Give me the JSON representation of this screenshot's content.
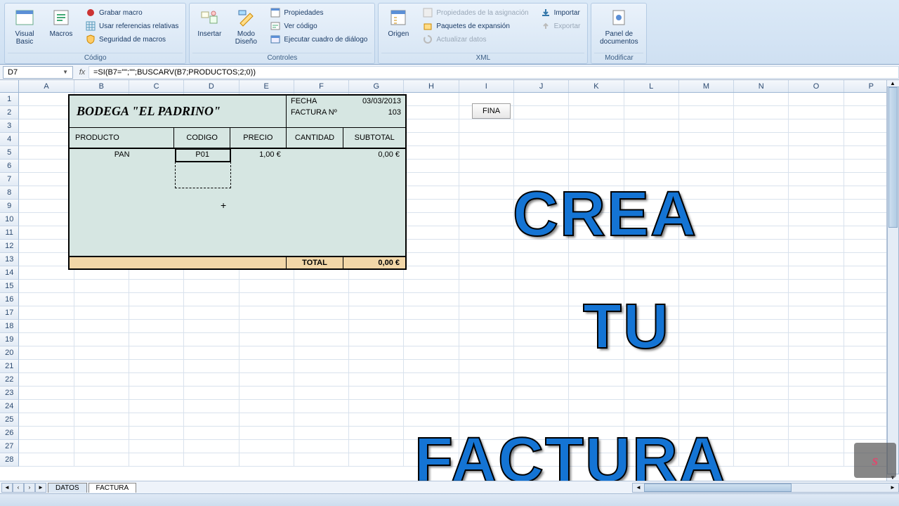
{
  "ribbon": {
    "codigo": {
      "label": "Código",
      "visual_basic": "Visual\nBasic",
      "macros": "Macros",
      "grabar": "Grabar macro",
      "refs": "Usar referencias relativas",
      "seguridad": "Seguridad de macros"
    },
    "controles": {
      "label": "Controles",
      "insertar": "Insertar",
      "modo": "Modo\nDiseño",
      "props": "Propiedades",
      "codigo": "Ver código",
      "dialogo": "Ejecutar cuadro de diálogo"
    },
    "xml": {
      "label": "XML",
      "origen": "Origen",
      "asig": "Propiedades de la asignación",
      "paq": "Paquetes de expansión",
      "act": "Actualizar datos",
      "importar": "Importar",
      "exportar": "Exportar"
    },
    "modificar": {
      "label": "Modificar",
      "panel": "Panel de\ndocumentos"
    }
  },
  "namebox": "D7",
  "formula": "=SI(B7=\"\";\"\";BUSCARV(B7;PRODUCTOS;2;0))",
  "columns": [
    "A",
    "B",
    "C",
    "D",
    "E",
    "F",
    "G",
    "H",
    "I",
    "J",
    "K",
    "L",
    "M",
    "N",
    "O",
    "P"
  ],
  "invoice": {
    "title": "BODEGA \"EL PADRINO\"",
    "fecha_lbl": "FECHA",
    "fecha_val": "03/03/2013",
    "num_lbl": "FACTURA Nº",
    "num_val": "103",
    "cols": {
      "producto": "PRODUCTO",
      "codigo": "CODIGO",
      "precio": "PRECIO",
      "cantidad": "CANTIDAD",
      "subtotal": "SUBTOTAL"
    },
    "line1": {
      "producto": "PAN",
      "codigo": "P01",
      "precio": "1,00 €",
      "subtotal": "0,00 €"
    },
    "total_lbl": "TOTAL",
    "total_val": "0,00 €"
  },
  "button_fina": "FINA",
  "overlay": {
    "l1": "CREA",
    "l2": "TU",
    "l3": "FACTURA"
  },
  "tabs": {
    "datos": "DATOS",
    "factura": "FACTURA"
  }
}
